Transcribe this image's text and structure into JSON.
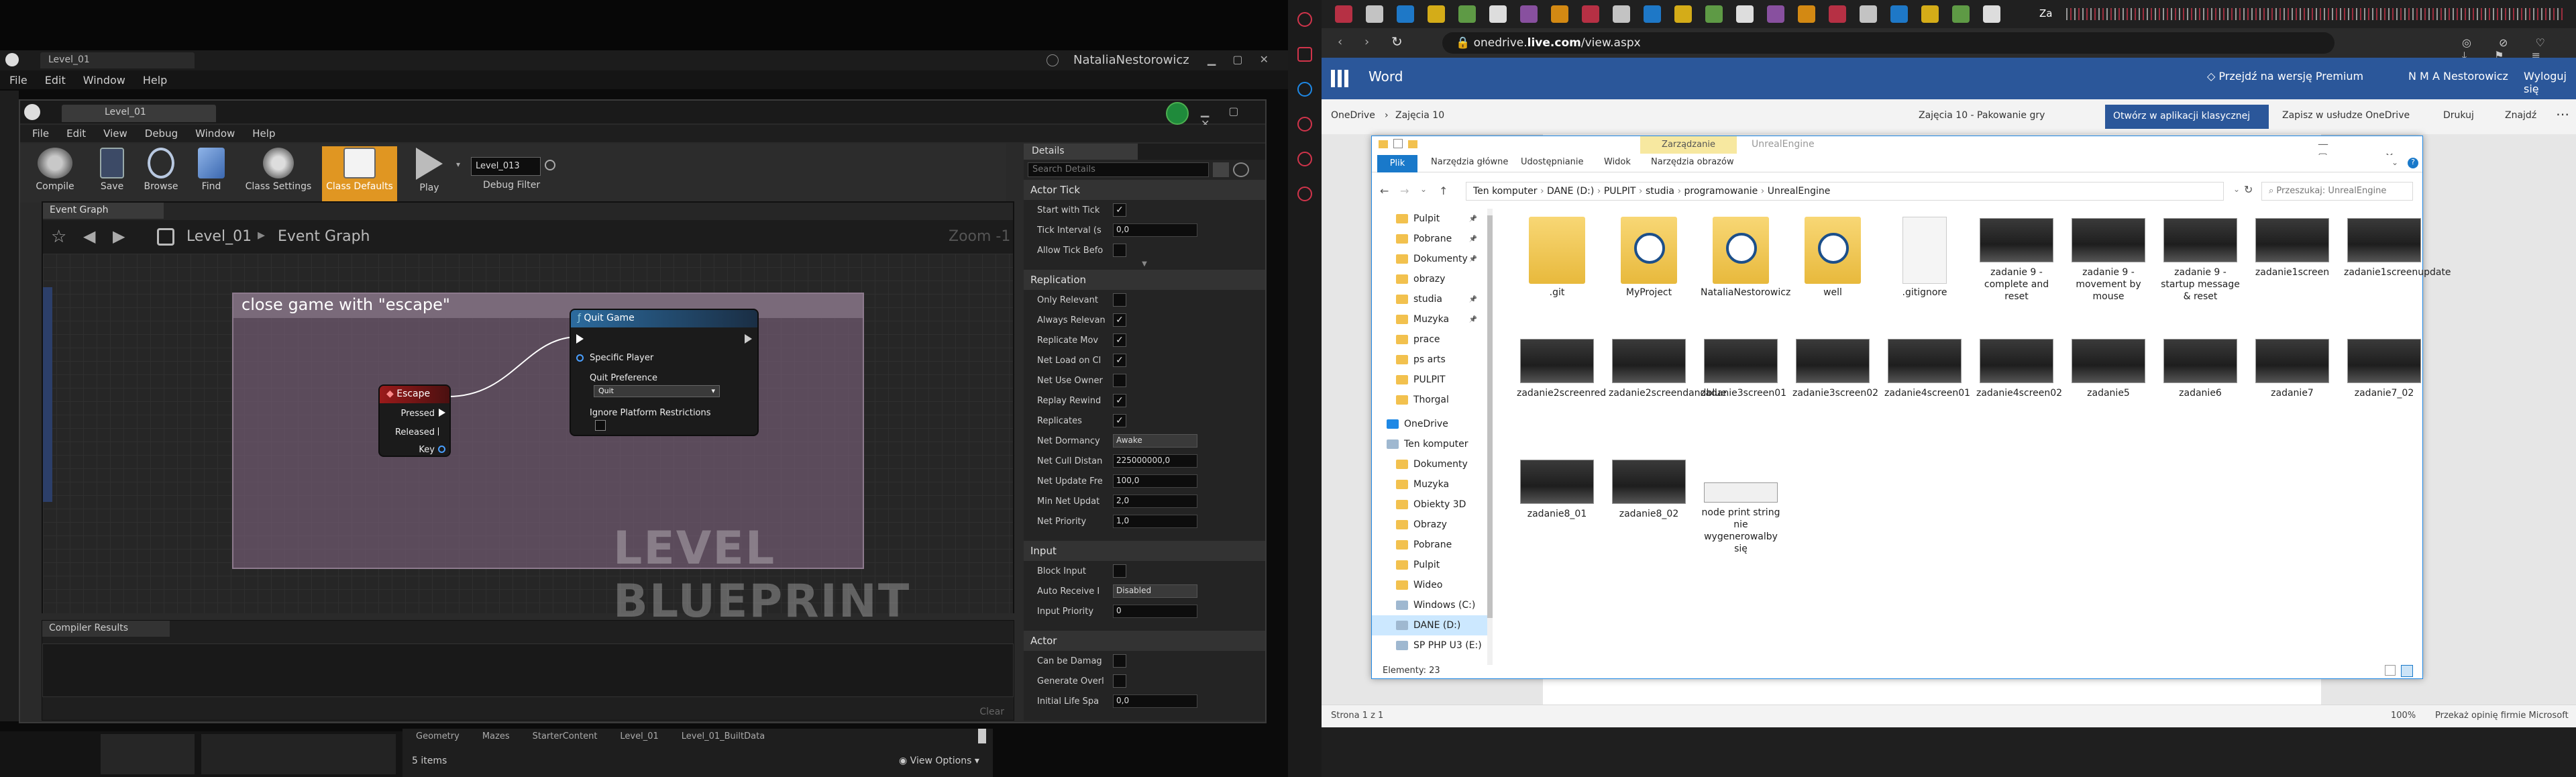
{
  "ue_main": {
    "tab": "Level_01",
    "user": "NataliaNestorowicz",
    "menu": [
      "File",
      "Edit",
      "Window",
      "Help"
    ]
  },
  "bp_window": {
    "tab": "Level_01",
    "menu": [
      "File",
      "Edit",
      "View",
      "Debug",
      "Window",
      "Help"
    ],
    "toolbar": [
      "Compile",
      "Save",
      "Browse",
      "Find",
      "Class Settings",
      "Class Defaults",
      "Play"
    ],
    "debug_object": "Level_013",
    "debug_filter": "Debug Filter",
    "graph_tab": "Event Graph",
    "breadcrumb_level": "Level_01",
    "breadcrumb_graph": "Event Graph",
    "zoom": "Zoom -1",
    "watermark": "LEVEL BLUEPRINT",
    "comment_title": "close game with \"escape\"",
    "escape_node": {
      "title": "Escape",
      "pins": [
        "Pressed",
        "Released",
        "Key"
      ]
    },
    "quit_node": {
      "title": "Quit Game",
      "player": "Specific Player",
      "pref_label": "Quit Preference",
      "pref_value": "Quit",
      "ignore_label": "Ignore Platform Restrictions"
    },
    "compiler_tab": "Compiler Results",
    "clear": "Clear"
  },
  "details": {
    "tab": "Details",
    "search_placeholder": "Search Details",
    "sections": {
      "actor_tick": "Actor Tick",
      "replication": "Replication",
      "input": "Input",
      "actor": "Actor"
    },
    "actor_tick": [
      {
        "label": "Start with Tick",
        "type": "check",
        "value": "✓"
      },
      {
        "label": "Tick Interval (s",
        "type": "num",
        "value": "0,0"
      },
      {
        "label": "Allow Tick Befo",
        "type": "check",
        "value": ""
      }
    ],
    "replication": [
      {
        "label": "Only Relevant",
        "type": "check",
        "value": ""
      },
      {
        "label": "Always Relevan",
        "type": "check",
        "value": "✓"
      },
      {
        "label": "Replicate Mov",
        "type": "check",
        "value": "✓"
      },
      {
        "label": "Net Load on Cl",
        "type": "check",
        "value": "✓"
      },
      {
        "label": "Net Use Owner",
        "type": "check",
        "value": ""
      },
      {
        "label": "Replay Rewind",
        "type": "check",
        "value": "✓"
      },
      {
        "label": "Replicates",
        "type": "check",
        "value": "✓"
      },
      {
        "label": "Net Dormancy",
        "type": "dd",
        "value": "Awake"
      },
      {
        "label": "Net Cull Distan",
        "type": "num",
        "value": "225000000,0"
      },
      {
        "label": "Net Update Fre",
        "type": "num",
        "value": "100,0"
      },
      {
        "label": "Min Net Updat",
        "type": "num",
        "value": "2,0"
      },
      {
        "label": "Net Priority",
        "type": "num",
        "value": "1,0"
      }
    ],
    "input": [
      {
        "label": "Block Input",
        "type": "check",
        "value": ""
      },
      {
        "label": "Auto Receive I",
        "type": "dd",
        "value": "Disabled"
      },
      {
        "label": "Input Priority",
        "type": "num",
        "value": "0"
      }
    ],
    "actor": [
      {
        "label": "Can be Damag",
        "type": "check",
        "value": ""
      },
      {
        "label": "Generate Overl",
        "type": "check",
        "value": ""
      },
      {
        "label": "Initial Life Spa",
        "type": "num",
        "value": "0,0"
      }
    ]
  },
  "content_browser": {
    "folders": [
      "Geometry",
      "Mazes",
      "StarterContent",
      "Level_01",
      "Level_01_BuiltData"
    ],
    "count": "5 items",
    "view_options": "View Options"
  },
  "browser": {
    "url_host": "onedrive.",
    "url_bold": "live.com",
    "url_path": "/view.aspx",
    "tab_label": "Za"
  },
  "word": {
    "app": "Word",
    "premium": "Przejdź na wersję Premium",
    "user": "N M A Nestorowicz",
    "logout": "Wyloguj się",
    "breadcrumb_root": "OneDrive",
    "breadcrumb_folder": "Zajęcia 10",
    "doc_title": "Zajęcia 10 - Pakowanie gry",
    "open_desktop": "Otwórz w aplikacji klasycznej",
    "save_onedrive": "Zapisz w usłudze OneDrive",
    "print": "Drukuj",
    "find": "Znajdź",
    "page_status": "Strona 1 z 1",
    "zoom": "100%",
    "feedback": "Przekaż opinię firmie Microsoft"
  },
  "explorer": {
    "context_tab": "Zarządzanie",
    "title": "UnrealEngine",
    "ribbon": [
      "Plik",
      "Narzędzia główne",
      "Udostępnianie",
      "Widok",
      "Narzędzia obrazów"
    ],
    "path": [
      "Ten komputer",
      "DANE (D:)",
      "PULPIT",
      "studia",
      "programowanie",
      "UnrealEngine"
    ],
    "search_placeholder": "Przeszukaj: UnrealEngine",
    "nav": [
      "Pulpit",
      "Pobrane",
      "Dokumenty",
      "obrazy",
      "studia",
      "Muzyka",
      "prace",
      "ps arts",
      "PULPIT",
      "Thorgal",
      "OneDrive",
      "Ten komputer",
      "Dokumenty",
      "Muzyka",
      "Obiekty 3D",
      "Obrazy",
      "Pobrane",
      "Pulpit",
      "Wideo",
      "Windows (C:)",
      "DANE (D:)",
      "SP PHP U3 (E:)"
    ],
    "items": [
      {
        "name": ".git",
        "kind": "folder"
      },
      {
        "name": "MyProject",
        "kind": "ue-folder"
      },
      {
        "name": "NataliaNestorowicz",
        "kind": "ue-folder"
      },
      {
        "name": "well",
        "kind": "ue-folder"
      },
      {
        "name": ".gitignore",
        "kind": "file"
      },
      {
        "name": "zadanie 9 - complete and reset",
        "kind": "img"
      },
      {
        "name": "zadanie 9 - movement by mouse",
        "kind": "img"
      },
      {
        "name": "zadanie 9 - startup message & reset",
        "kind": "img"
      },
      {
        "name": "zadanie1screen",
        "kind": "img"
      },
      {
        "name": "zadanie1screenupdate",
        "kind": "img"
      },
      {
        "name": "zadanie2screenred",
        "kind": "img"
      },
      {
        "name": "zadanie2screendandblue",
        "kind": "img"
      },
      {
        "name": "zadanie3screen01",
        "kind": "img"
      },
      {
        "name": "zadanie3screen02",
        "kind": "img"
      },
      {
        "name": "zadanie4screen01",
        "kind": "img"
      },
      {
        "name": "zadanie4screen02",
        "kind": "img"
      },
      {
        "name": "zadanie5",
        "kind": "img"
      },
      {
        "name": "zadanie6",
        "kind": "img"
      },
      {
        "name": "zadanie7",
        "kind": "img"
      },
      {
        "name": "zadanie7_02",
        "kind": "img"
      },
      {
        "name": "zadanie8_01",
        "kind": "img"
      },
      {
        "name": "zadanie8_02",
        "kind": "img"
      },
      {
        "name": "node print string nie wygenerowalby się",
        "kind": "img-light"
      }
    ],
    "status": "Elementy: 23"
  }
}
